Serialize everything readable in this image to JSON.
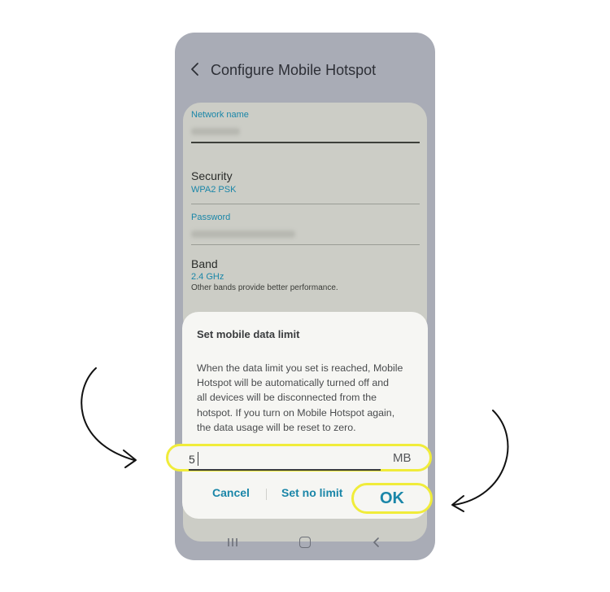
{
  "header": {
    "title": "Configure Mobile Hotspot"
  },
  "settings": {
    "network_name_label": "Network name",
    "security_label": "Security",
    "security_value": "WPA2 PSK",
    "password_label": "Password",
    "band_label": "Band",
    "band_value": "2.4 GHz",
    "band_note": "Other bands provide better performance."
  },
  "dialog": {
    "title": "Set mobile data limit",
    "body_lines": [
      "When the data limit you set is reached, Mobile",
      "Hotspot will be automatically turned off and",
      "all devices will be disconnected from the",
      "hotspot. If you turn on Mobile Hotspot again,",
      "the data usage will be reset to zero."
    ],
    "limit_value": "5",
    "unit": "MB",
    "cancel_label": "Cancel",
    "no_limit_label": "Set no limit",
    "ok_label": "OK"
  },
  "colors": {
    "accent": "#1a86a8",
    "highlight": "#f0ec3a",
    "phone_bg": "#a9acb6",
    "card_bg": "#cccdc6",
    "dialog_bg": "#f6f6f3"
  },
  "icons": {
    "back": "chevron-left-icon",
    "recents": "recents-icon",
    "home": "home-icon",
    "nav_back": "back-nav-icon",
    "annotation_left": "curved-arrow-icon",
    "annotation_right": "curved-arrow-icon"
  }
}
